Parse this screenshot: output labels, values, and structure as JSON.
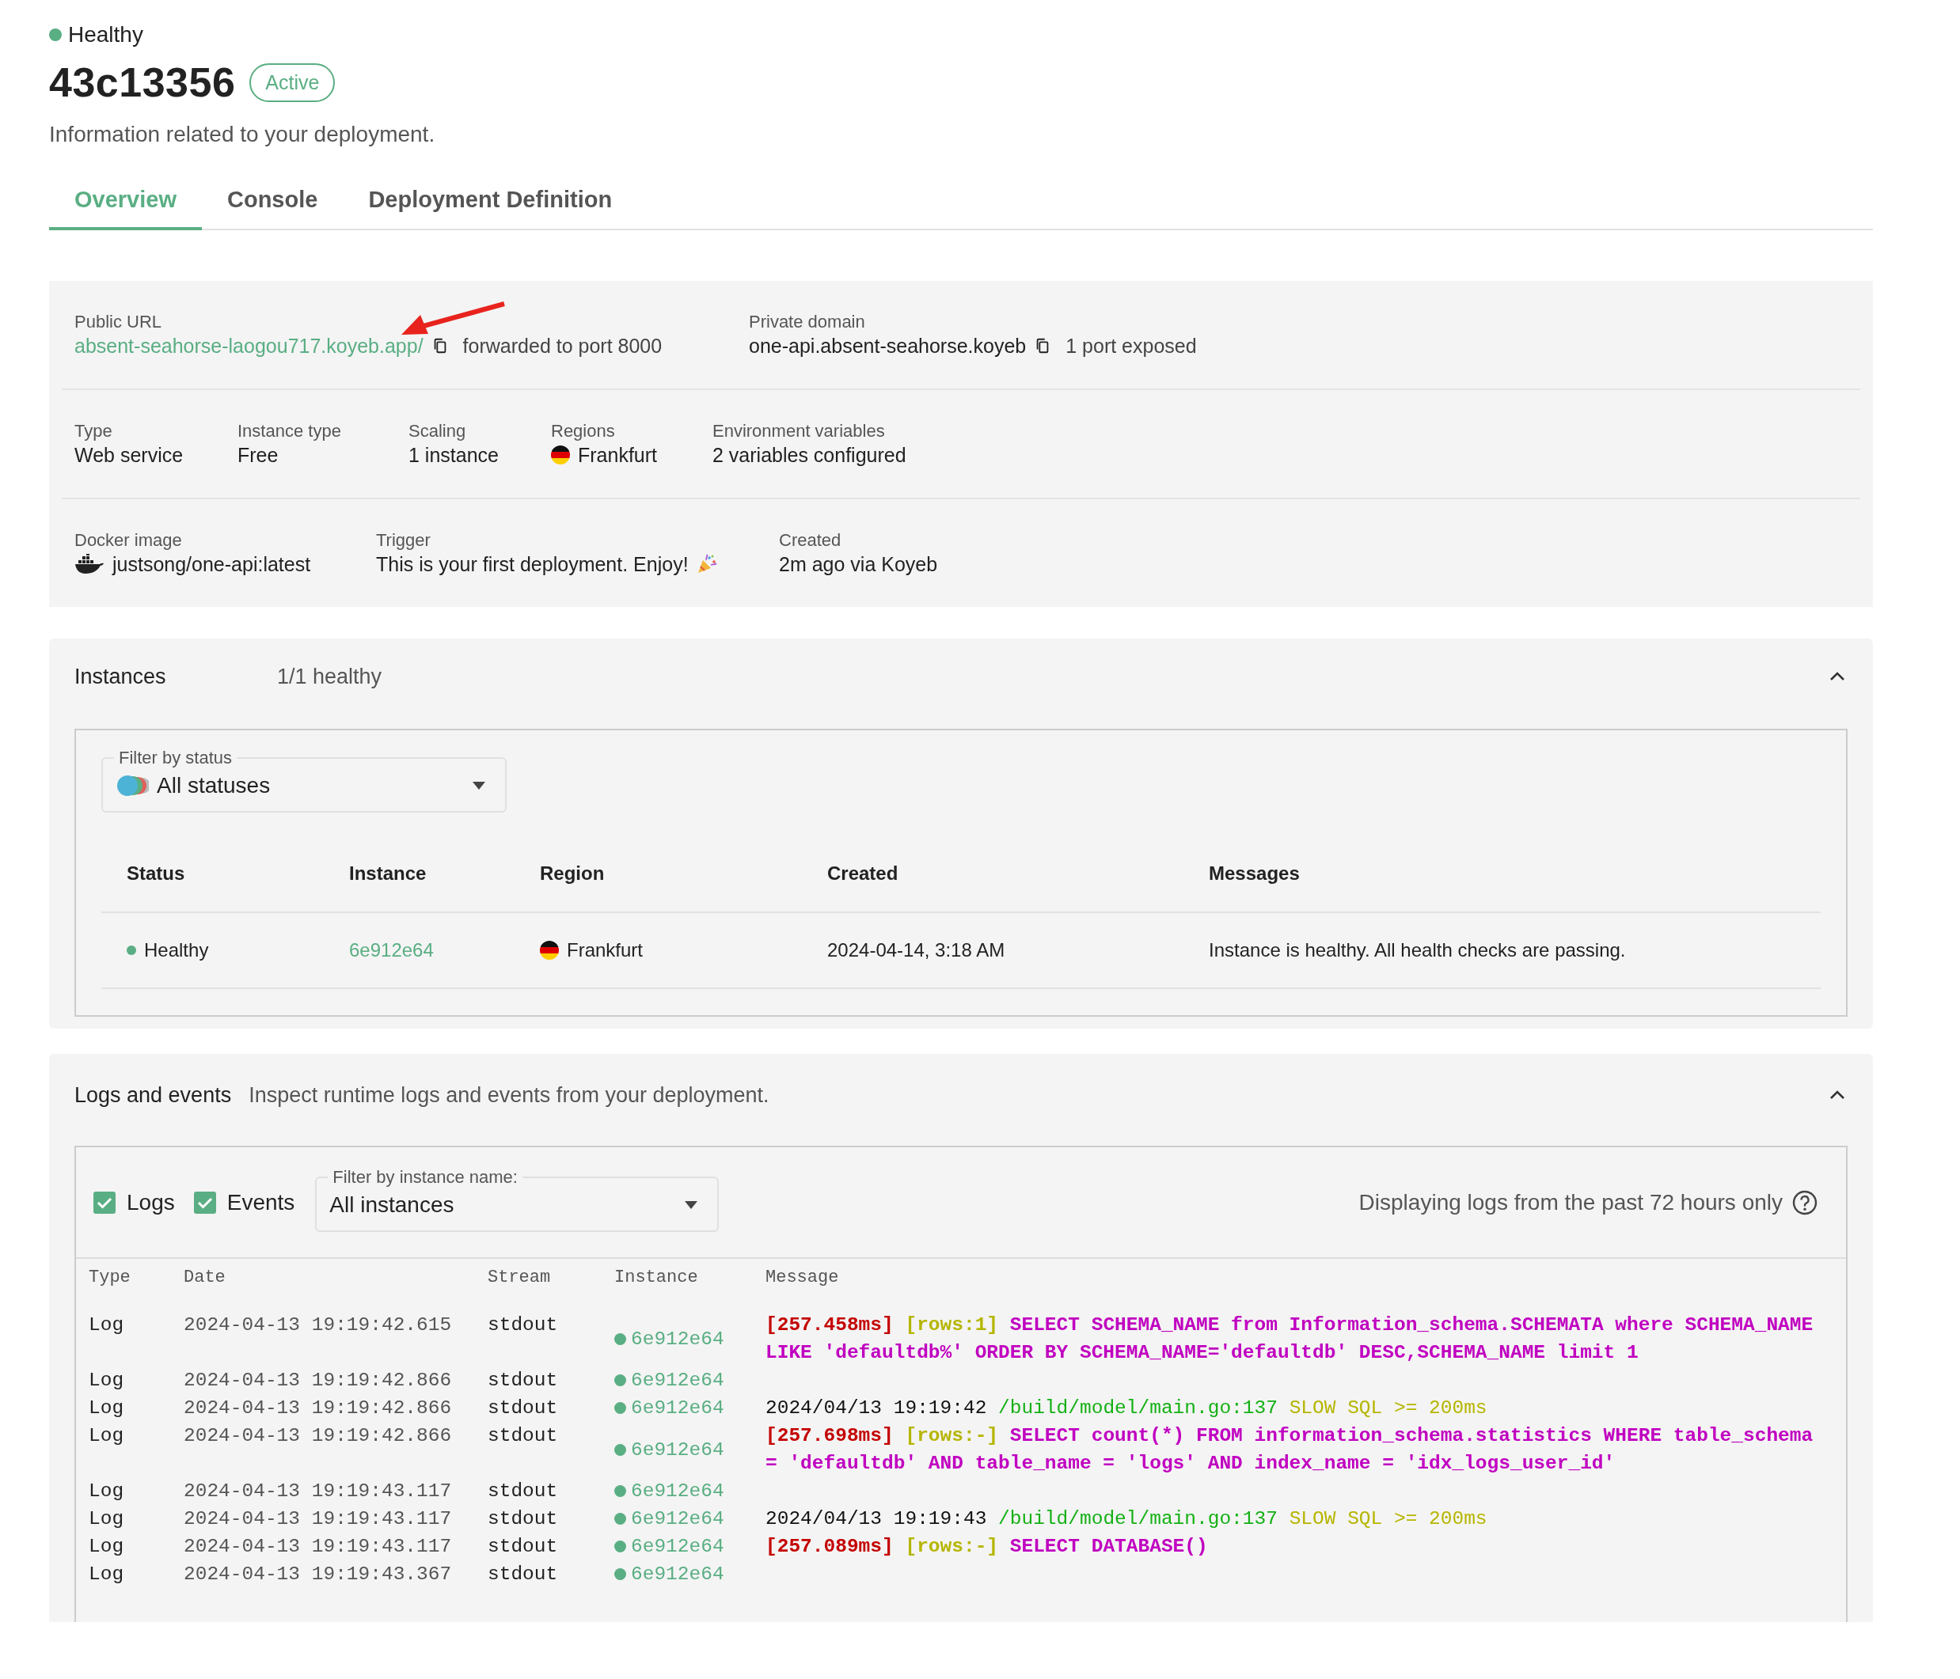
{
  "status": {
    "label": "Healthy"
  },
  "title": "43c13356",
  "badge": "Active",
  "subtitle": "Information related to your deployment.",
  "tabs": [
    {
      "label": "Overview",
      "selected": true
    },
    {
      "label": "Console",
      "selected": false
    },
    {
      "label": "Deployment Definition",
      "selected": false
    }
  ],
  "overview": {
    "public_url": {
      "label": "Public URL",
      "link": "absent-seahorse-laogou717.koyeb.app/",
      "note": "forwarded to port 8000"
    },
    "private_domain": {
      "label": "Private domain",
      "value": "one-api.absent-seahorse.koyeb",
      "note": "1 port exposed"
    },
    "details": [
      {
        "label": "Type",
        "value": "Web service"
      },
      {
        "label": "Instance type",
        "value": "Free"
      },
      {
        "label": "Scaling",
        "value": "1 instance"
      },
      {
        "label": "Regions",
        "value": "Frankfurt",
        "kind": "flag"
      },
      {
        "label": "Environment variables",
        "value": "2 variables configured"
      }
    ],
    "build": [
      {
        "label": "Docker image",
        "value": "justsong/one-api:latest",
        "kind": "docker"
      },
      {
        "label": "Trigger",
        "value": "This is your first deployment. Enjoy!",
        "kind": "party"
      },
      {
        "label": "Created",
        "value": "2m ago via Koyeb"
      }
    ]
  },
  "instances": {
    "title": "Instances",
    "summary": "1/1 healthy",
    "expanded": true,
    "filter": {
      "label": "Filter by status",
      "value": "All statuses"
    },
    "columns": [
      "Status",
      "Instance",
      "Region",
      "Created",
      "Messages"
    ],
    "rows": [
      {
        "status": "Healthy",
        "instance": "6e912e64",
        "region": "Frankfurt",
        "created": "2024-04-14, 3:18 AM",
        "message": "Instance is healthy. All health checks are passing."
      }
    ]
  },
  "logs": {
    "title": "Logs and events",
    "subtitle": "Inspect runtime logs and events from your deployment.",
    "expanded": true,
    "toggles": [
      {
        "label": "Logs",
        "checked": true
      },
      {
        "label": "Events",
        "checked": true
      }
    ],
    "filter": {
      "label": "Filter by instance name:",
      "value": "All instances"
    },
    "notice": "Displaying logs from the past 72 hours only",
    "columns": [
      "Type",
      "Date",
      "Stream",
      "Instance",
      "Message"
    ],
    "rows": [
      {
        "type": "Log",
        "date": "2024-04-13 19:19:42.615",
        "stream": "stdout",
        "instance": "6e912e64",
        "message": [
          {
            "kind": "time",
            "text": "[257.458ms]"
          },
          {
            "kind": "rows",
            "text": "[rows:1]"
          },
          {
            "kind": "sql",
            "text": "SELECT SCHEMA_NAME from Information_schema.SCHEMATA where SCHEMA_NAME LIKE 'defaultdb%' ORDER BY SCHEMA_NAME='defaultdb' DESC,SCHEMA_NAME limit 1"
          }
        ]
      },
      {
        "type": "Log",
        "date": "2024-04-13 19:19:42.866",
        "stream": "stdout",
        "instance": "6e912e64"
      },
      {
        "type": "Log",
        "date": "2024-04-13 19:19:42.866",
        "stream": "stdout",
        "instance": "6e912e64",
        "message": [
          {
            "kind": "plain",
            "text": "2024/04/13 19:19:42"
          },
          {
            "kind": "path",
            "text": "/build/model/main.go:137"
          },
          {
            "kind": "slow",
            "text": "SLOW SQL >= 200ms"
          }
        ]
      },
      {
        "type": "Log",
        "date": "2024-04-13 19:19:42.866",
        "stream": "stdout",
        "instance": "6e912e64",
        "message": [
          {
            "kind": "time",
            "text": "[257.698ms]"
          },
          {
            "kind": "rows",
            "text": "[rows:-]"
          },
          {
            "kind": "sql",
            "text": "SELECT count(*) FROM information_schema.statistics WHERE table_schema = 'defaultdb' AND table_name = 'logs' AND index_name = 'idx_logs_user_id'"
          }
        ]
      },
      {
        "type": "Log",
        "date": "2024-04-13 19:19:43.117",
        "stream": "stdout",
        "instance": "6e912e64"
      },
      {
        "type": "Log",
        "date": "2024-04-13 19:19:43.117",
        "stream": "stdout",
        "instance": "6e912e64",
        "message": [
          {
            "kind": "plain",
            "text": "2024/04/13 19:19:43"
          },
          {
            "kind": "path",
            "text": "/build/model/main.go:137"
          },
          {
            "kind": "slow",
            "text": "SLOW SQL >= 200ms"
          }
        ]
      },
      {
        "type": "Log",
        "date": "2024-04-13 19:19:43.117",
        "stream": "stdout",
        "instance": "6e912e64",
        "message": [
          {
            "kind": "time",
            "text": "[257.089ms]"
          },
          {
            "kind": "rows",
            "text": "[rows:-]"
          },
          {
            "kind": "sql",
            "text": "SELECT DATABASE()"
          }
        ]
      },
      {
        "type": "Log",
        "date": "2024-04-13 19:19:43.367",
        "stream": "stdout",
        "instance": "6e912e64"
      }
    ]
  }
}
